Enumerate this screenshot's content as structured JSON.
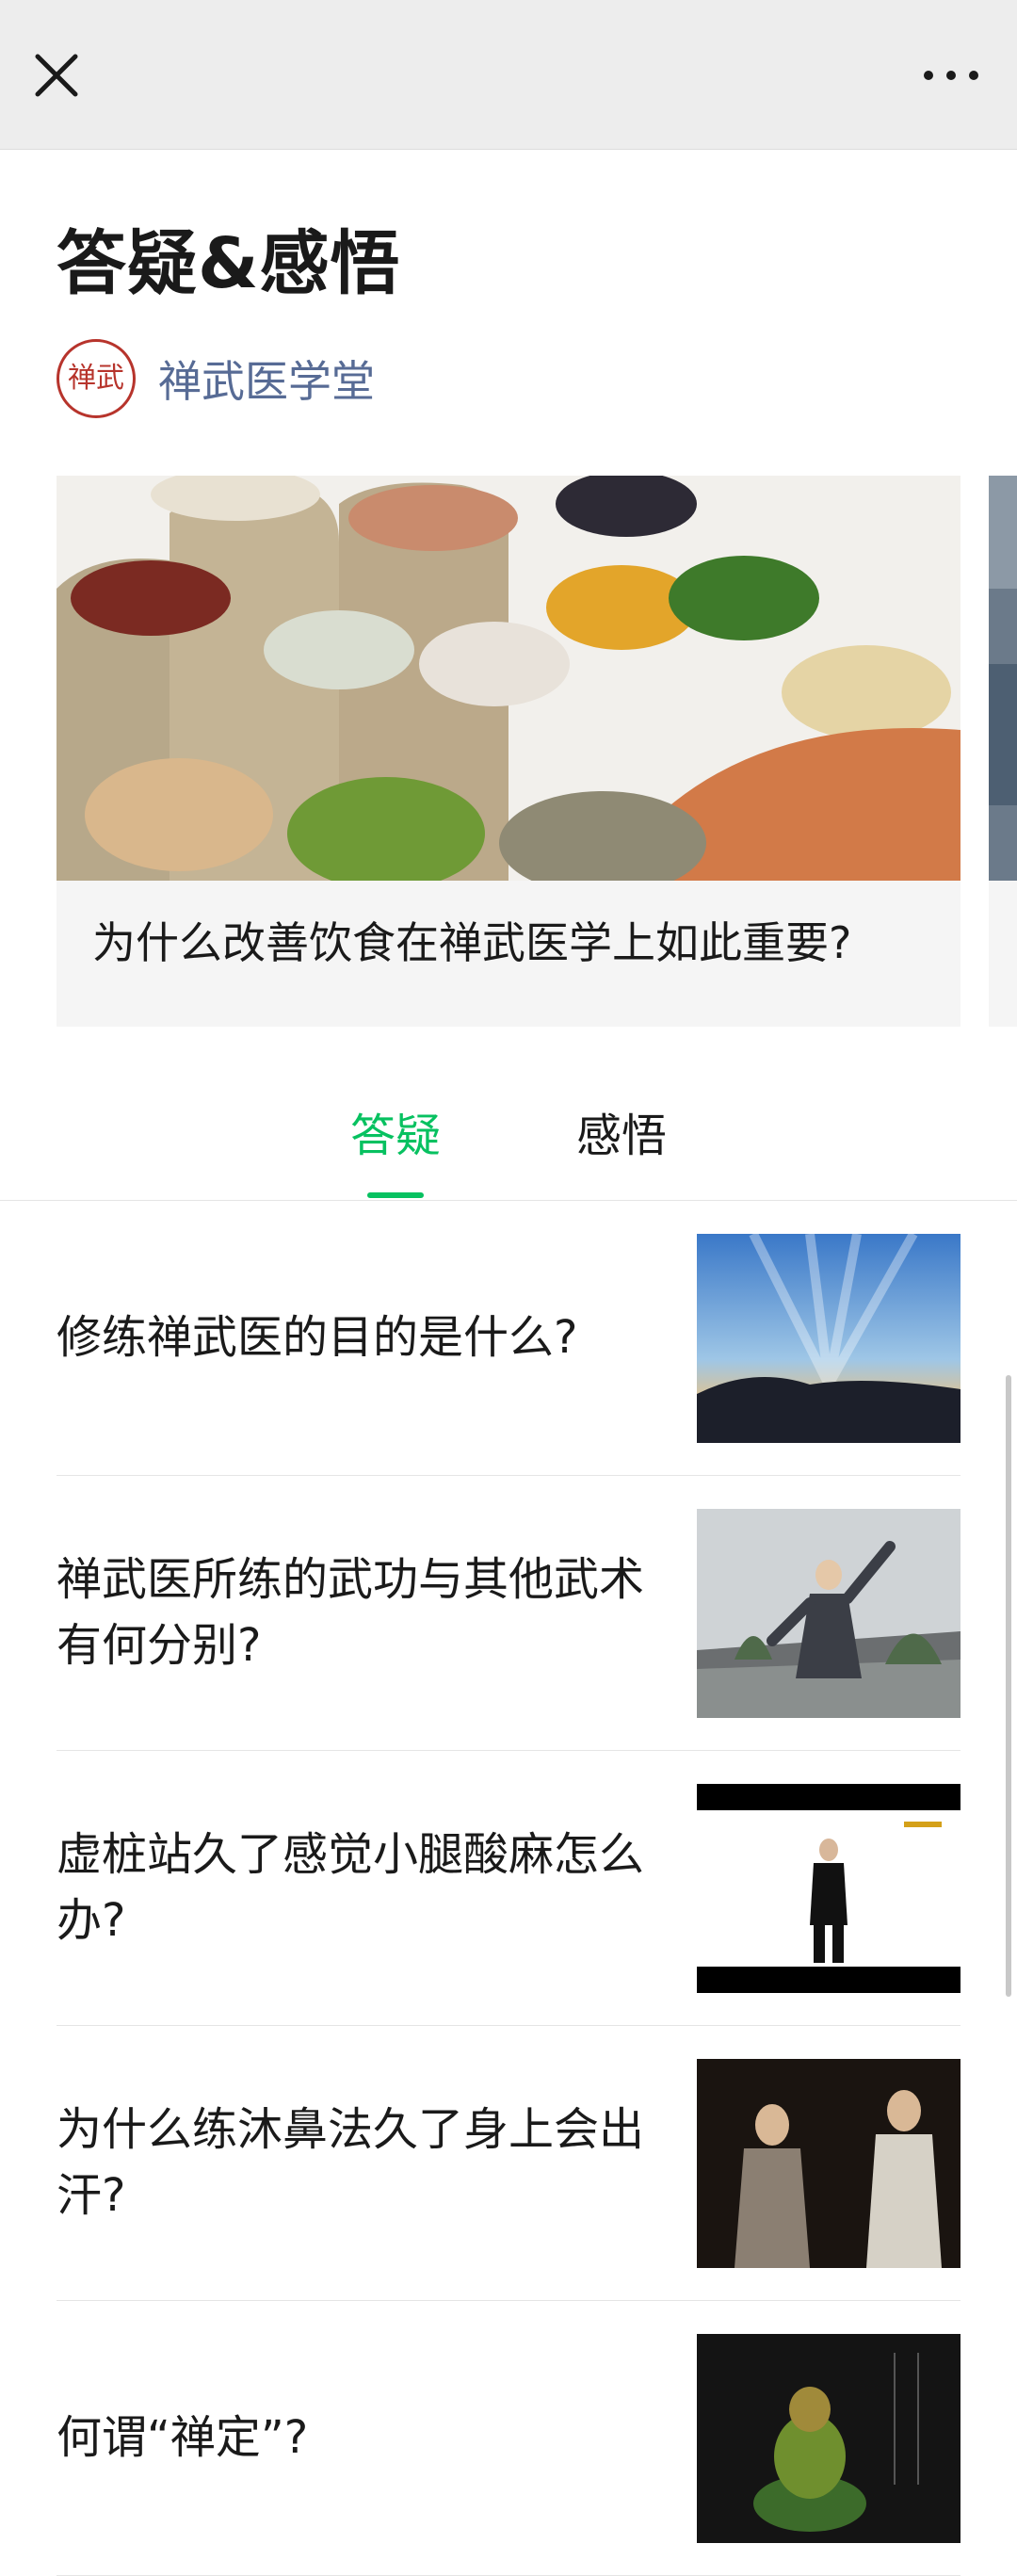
{
  "topbar": {
    "close_icon": "close-icon",
    "more_icon": "more-icon"
  },
  "article": {
    "title": "答疑&感悟",
    "author": "禅武医学堂",
    "seal_text": "禅武"
  },
  "carousel": {
    "items": [
      {
        "caption": "为什么改善饮食在禅武医学上如此重要?"
      }
    ]
  },
  "tabs": [
    {
      "label": "答疑",
      "active": true
    },
    {
      "label": "感悟",
      "active": false
    }
  ],
  "list": {
    "items": [
      {
        "title": "修练禅武医的目的是什么?"
      },
      {
        "title": "禅武医所练的武功与其他武术有何分别?"
      },
      {
        "title": "虚桩站久了感觉小腿酸麻怎么办?"
      },
      {
        "title": "为什么练沐鼻法久了身上会出汗?"
      },
      {
        "title": "何谓“禅定”?"
      }
    ]
  },
  "colors": {
    "accent": "#07c160",
    "author": "#576b95",
    "seal": "#b7342c"
  }
}
